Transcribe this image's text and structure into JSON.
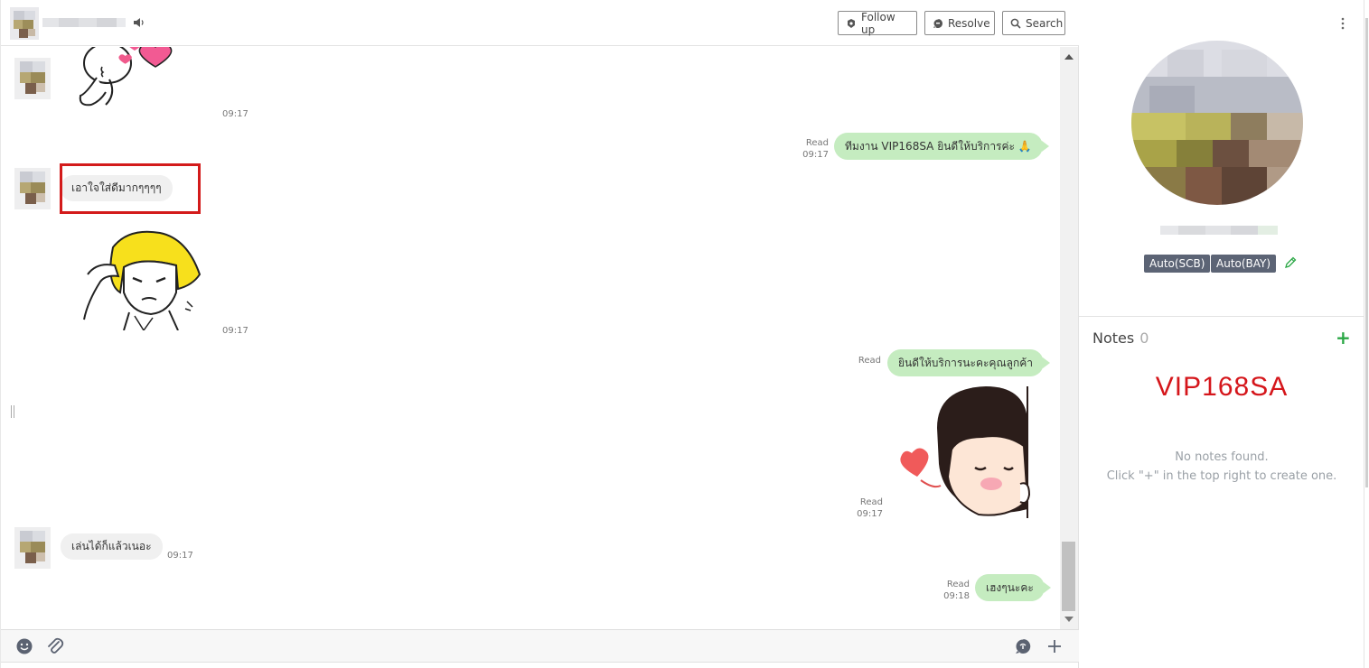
{
  "header": {
    "buttons": {
      "follow_up": "Follow up",
      "resolve": "Resolve",
      "search": "Search"
    }
  },
  "messages": {
    "sticker1_time": "09:17",
    "out1": {
      "status": "Read",
      "time": "09:17",
      "text": "ทีมงาน VIP168SA ยินดีให้บริการค่ะ 🙏"
    },
    "in1": {
      "text": "เอาใจใส่ดีมากๆๆๆๆ"
    },
    "sticker2_time": "09:17",
    "out2": {
      "status": "Read",
      "text": "ยินดีให้บริการนะคะคุณลูกค้า"
    },
    "sticker3": {
      "status": "Read",
      "time": "09:17"
    },
    "in2": {
      "text": "เล่นได้ก็แล้วเนอะ",
      "time": "09:17"
    },
    "out3": {
      "status": "Read",
      "time": "09:18",
      "text": "เฮงๆนะคะ"
    }
  },
  "sidebar": {
    "tags": [
      "Auto(SCB)",
      "Auto(BAY)"
    ],
    "notes": {
      "title": "Notes",
      "count": "0",
      "add": "+",
      "brand": "VIP168SA",
      "empty_line1": "No notes found.",
      "empty_line2": "Click \"+\" in the top right to create one."
    }
  },
  "colors": {
    "outgoing_bubble": "#c5ecc0",
    "incoming_bubble": "#f0f0f0",
    "tag_bg": "#5c6475",
    "brand_red": "#d5161b",
    "add_green": "#2aa745",
    "highlight_border": "#d31b1b"
  },
  "icons": [
    "speaker-icon",
    "follow-up-icon",
    "resolve-icon",
    "search-icon",
    "emoji-icon",
    "attachment-icon",
    "chat-template-icon",
    "plus-icon",
    "kebab-menu-icon",
    "pencil-icon"
  ]
}
